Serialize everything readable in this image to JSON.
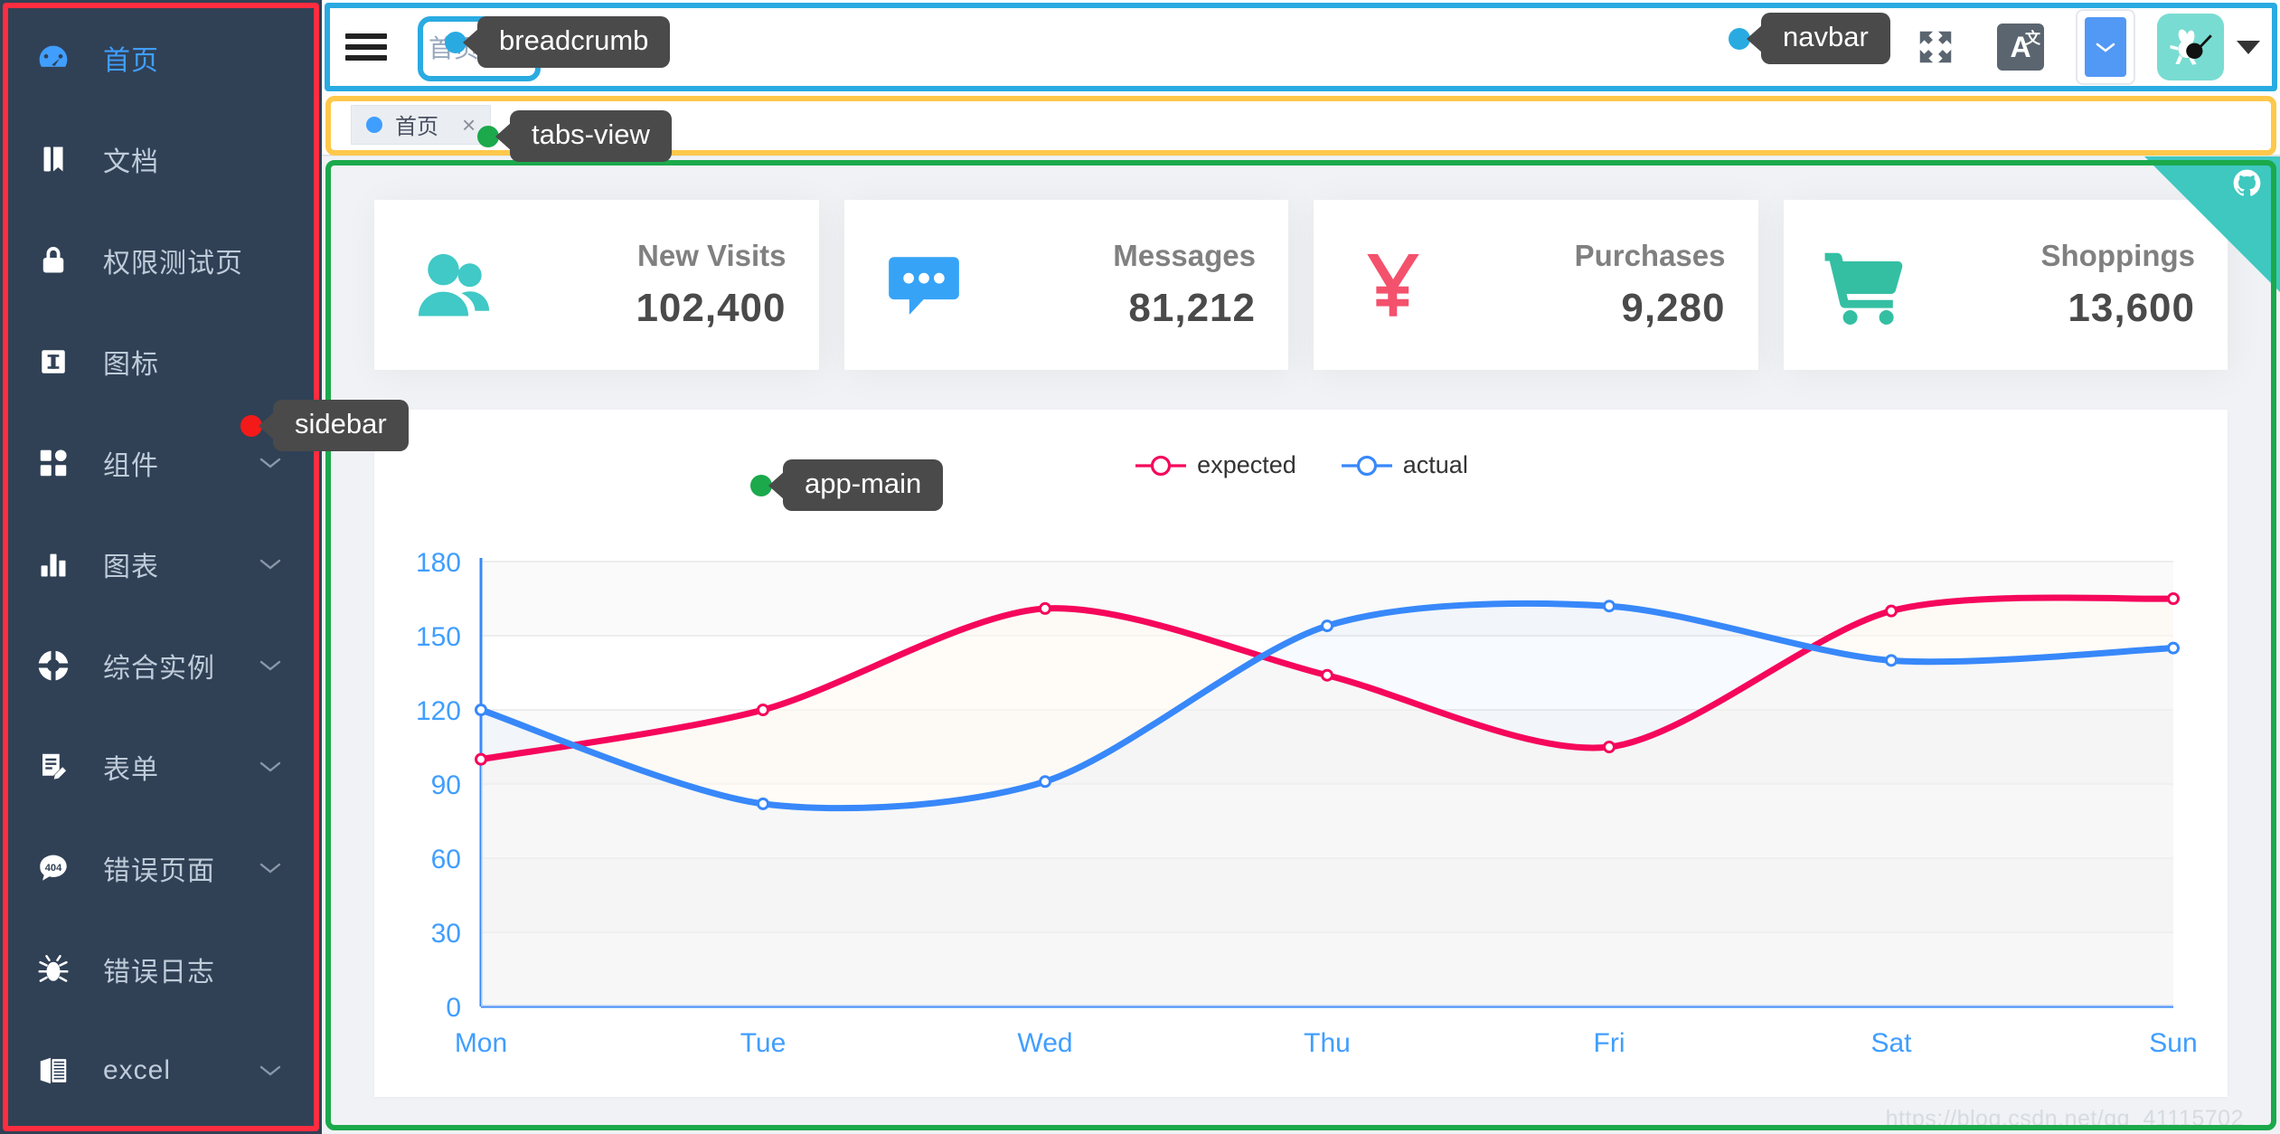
{
  "sidebar": {
    "callout": {
      "label": "sidebar",
      "dot_color": "#f41a1a",
      "outline_color": "#ff2d3f"
    },
    "items": [
      {
        "label": "首页",
        "icon": "dashboard-icon",
        "active": true,
        "expandable": false
      },
      {
        "label": "文档",
        "icon": "document-icon",
        "active": false,
        "expandable": false
      },
      {
        "label": "权限测试页",
        "icon": "lock-icon",
        "active": false,
        "expandable": false
      },
      {
        "label": "图标",
        "icon": "icon-set-icon",
        "active": false,
        "expandable": false
      },
      {
        "label": "组件",
        "icon": "component-icon",
        "active": false,
        "expandable": true
      },
      {
        "label": "图表",
        "icon": "chart-bar-icon",
        "active": false,
        "expandable": true
      },
      {
        "label": "综合实例",
        "icon": "lifebuoy-icon",
        "active": false,
        "expandable": true
      },
      {
        "label": "表单",
        "icon": "form-edit-icon",
        "active": false,
        "expandable": true
      },
      {
        "label": "错误页面",
        "icon": "error-404-icon",
        "active": false,
        "expandable": true
      },
      {
        "label": "错误日志",
        "icon": "bug-icon",
        "active": false,
        "expandable": false
      },
      {
        "label": "excel",
        "icon": "excel-icon",
        "active": false,
        "expandable": true
      }
    ]
  },
  "navbar": {
    "callout": {
      "label": "navbar",
      "dot_color": "#29abe2",
      "outline_color": "#29abe2"
    },
    "hamburger_icon": "hamburger-icon",
    "breadcrumb": {
      "callout": {
        "label": "breadcrumb",
        "dot_color": "#29abe2",
        "outline_color": "#29abe2"
      },
      "items": [
        "首页"
      ]
    },
    "fullscreen_icon": "fullscreen-icon",
    "lang_icon_main": "A",
    "lang_icon_sub": "文",
    "size_select_icon": "chevron-down-icon",
    "avatar_icon": "avatar-rabbit-icon",
    "avatar_caret_icon": "caret-down-icon"
  },
  "tags_view": {
    "callout": {
      "label": "tabs-view",
      "dot_color": "#1ba94c",
      "outline_color": "#ffc84b"
    },
    "tabs": [
      {
        "label": "首页",
        "active": true,
        "close_label": "×",
        "dot_color": "#409eff"
      }
    ]
  },
  "app_main": {
    "callout": {
      "label": "app-main",
      "dot_color": "#1ba94c",
      "outline_color": "#1ba94c"
    },
    "github_corner_icon": "github-octocat-icon",
    "cards": [
      {
        "title": "New Visits",
        "value": "102,400",
        "icon": "people-icon",
        "color": "#40c9c6"
      },
      {
        "title": "Messages",
        "value": "81,212",
        "icon": "message-icon",
        "color": "#36a3f7"
      },
      {
        "title": "Purchases",
        "value": "9,280",
        "icon": "money-yen-icon",
        "color": "#f4516c"
      },
      {
        "title": "Shoppings",
        "value": "13,600",
        "icon": "shopping-cart-icon",
        "color": "#34bfa3"
      }
    ],
    "watermark": "https://blog.csdn.net/qq_41115702"
  },
  "chart_data": {
    "type": "line",
    "title": "",
    "xlabel": "",
    "ylabel": "",
    "categories": [
      "Mon",
      "Tue",
      "Wed",
      "Thu",
      "Fri",
      "Sat",
      "Sun"
    ],
    "ylim": [
      0,
      180
    ],
    "yticks": [
      0,
      30,
      60,
      90,
      120,
      150,
      180
    ],
    "grid": true,
    "smooth": true,
    "legend_position": "top-center",
    "axis_label_color": "#409eff",
    "series": [
      {
        "name": "expected",
        "color": "#f5075b",
        "values": [
          100,
          120,
          161,
          134,
          105,
          160,
          165
        ]
      },
      {
        "name": "actual",
        "color": "#3888fa",
        "values": [
          120,
          82,
          91,
          154,
          162,
          140,
          145
        ]
      }
    ]
  }
}
